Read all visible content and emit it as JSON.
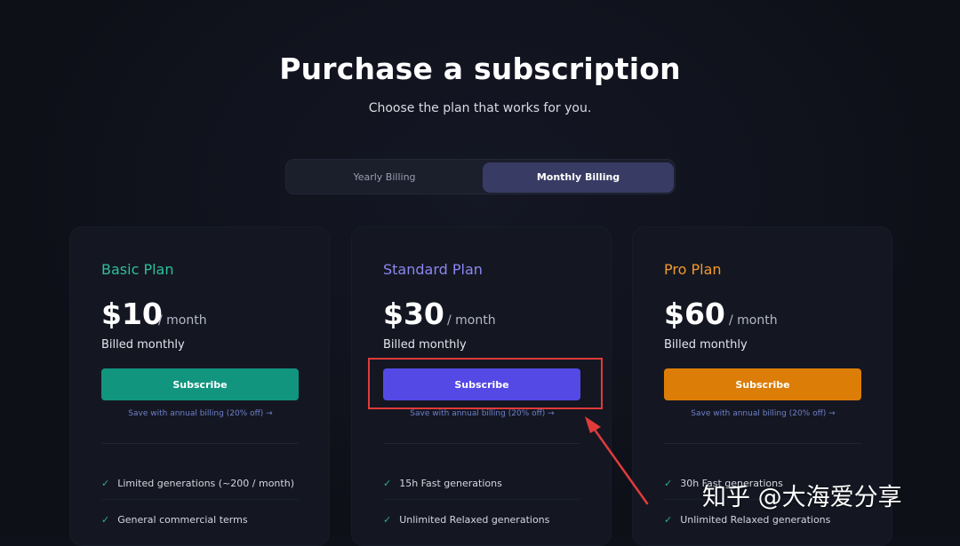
{
  "header": {
    "title": "Purchase a subscription",
    "subtitle": "Choose the plan that works for you."
  },
  "billing_toggle": {
    "options": [
      {
        "label": "Yearly Billing",
        "selected": false
      },
      {
        "label": "Monthly Billing",
        "selected": true
      }
    ]
  },
  "plans": [
    {
      "name": "Basic Plan",
      "price": "$10",
      "period": "/ month",
      "billed": "Billed monthly",
      "button_label": "Subscribe",
      "save_link": "Save with annual billing (20% off) →",
      "accent_color": "#2fbf9b",
      "button_color": "#12957f",
      "features": [
        "Limited generations (~200 / month)",
        "General commercial terms"
      ]
    },
    {
      "name": "Standard Plan",
      "price": "$30",
      "period": "/ month",
      "billed": "Billed monthly",
      "button_label": "Subscribe",
      "save_link": "Save with annual billing (20% off) →",
      "accent_color": "#8b87f0",
      "button_color": "#5549e6",
      "features": [
        "15h Fast generations",
        "Unlimited Relaxed generations"
      ]
    },
    {
      "name": "Pro Plan",
      "price": "$60",
      "period": "/ month",
      "billed": "Billed monthly",
      "button_label": "Subscribe",
      "save_link": "Save with annual billing (20% off) →",
      "accent_color": "#f29a2e",
      "button_color": "#dc7d07",
      "features": [
        "30h Fast generations",
        "Unlimited Relaxed generations"
      ]
    }
  ],
  "annotation": {
    "highlight_color": "#e03b3b"
  },
  "watermark": {
    "text": "知乎 @大海爱分享"
  },
  "icons": {
    "check": "check-icon",
    "arrow": "arrow-right-icon"
  }
}
